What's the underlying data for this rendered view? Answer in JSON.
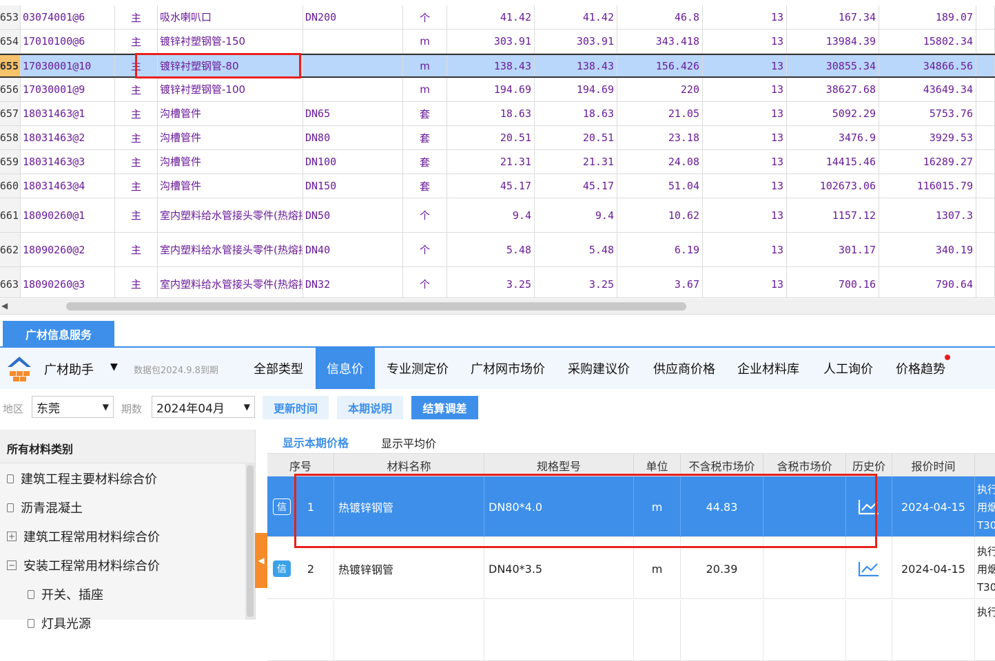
{
  "top_grid": {
    "rows": [
      {
        "idx": "653",
        "code": "03074001@6",
        "type": "主",
        "name": "吸水喇叭口",
        "spec": "DN200",
        "unit": "个",
        "p1": "41.42",
        "p2": "41.42",
        "p3": "46.8",
        "p4": "13",
        "p5": "167.34",
        "p6": "189.07"
      },
      {
        "idx": "654",
        "code": "17010100@6",
        "type": "主",
        "name": "镀锌衬塑钢管-150",
        "spec": "",
        "unit": "m",
        "p1": "303.91",
        "p2": "303.91",
        "p3": "343.418",
        "p4": "13",
        "p5": "13984.39",
        "p6": "15802.34"
      },
      {
        "idx": "655",
        "code": "17030001@10",
        "type": "主",
        "name": "镀锌衬塑钢管-80",
        "spec": "",
        "unit": "m",
        "p1": "138.43",
        "p2": "138.43",
        "p3": "156.426",
        "p4": "13",
        "p5": "30855.34",
        "p6": "34866.56"
      },
      {
        "idx": "656",
        "code": "17030001@9",
        "type": "主",
        "name": "镀锌衬塑钢管-100",
        "spec": "",
        "unit": "m",
        "p1": "194.69",
        "p2": "194.69",
        "p3": "220",
        "p4": "13",
        "p5": "38627.68",
        "p6": "43649.34"
      },
      {
        "idx": "657",
        "code": "18031463@1",
        "type": "主",
        "name": "沟槽管件",
        "spec": "DN65",
        "unit": "套",
        "p1": "18.63",
        "p2": "18.63",
        "p3": "21.05",
        "p4": "13",
        "p5": "5092.29",
        "p6": "5753.76"
      },
      {
        "idx": "658",
        "code": "18031463@2",
        "type": "主",
        "name": "沟槽管件",
        "spec": "DN80",
        "unit": "套",
        "p1": "20.51",
        "p2": "20.51",
        "p3": "23.18",
        "p4": "13",
        "p5": "3476.9",
        "p6": "3929.53"
      },
      {
        "idx": "659",
        "code": "18031463@3",
        "type": "主",
        "name": "沟槽管件",
        "spec": "DN100",
        "unit": "套",
        "p1": "21.31",
        "p2": "21.31",
        "p3": "24.08",
        "p4": "13",
        "p5": "14415.46",
        "p6": "16289.27"
      },
      {
        "idx": "660",
        "code": "18031463@4",
        "type": "主",
        "name": "沟槽管件",
        "spec": "DN150",
        "unit": "套",
        "p1": "45.17",
        "p2": "45.17",
        "p3": "51.04",
        "p4": "13",
        "p5": "102673.06",
        "p6": "116015.79"
      },
      {
        "idx": "661",
        "code": "18090260@1",
        "type": "主",
        "name": "室内塑料给水管接头零件(热熔接)",
        "spec": "DN50",
        "unit": "个",
        "p1": "9.4",
        "p2": "9.4",
        "p3": "10.62",
        "p4": "13",
        "p5": "1157.12",
        "p6": "1307.3"
      },
      {
        "idx": "662",
        "code": "18090260@2",
        "type": "主",
        "name": "室内塑料给水管接头零件(热熔接)",
        "spec": "DN40",
        "unit": "个",
        "p1": "5.48",
        "p2": "5.48",
        "p3": "6.19",
        "p4": "13",
        "p5": "301.17",
        "p6": "340.19"
      },
      {
        "idx": "663",
        "code": "18090260@3",
        "type": "主",
        "name": "室内塑料给水管接头零件(热熔接)",
        "spec": "DN32",
        "unit": "个",
        "p1": "3.25",
        "p2": "3.25",
        "p3": "3.67",
        "p4": "13",
        "p5": "700.16",
        "p6": "790.64"
      }
    ],
    "selected_index": 2,
    "ellipsis": "···"
  },
  "service": {
    "tab_label": "广材信息服务",
    "assistant_label": "广材助手",
    "package_text": "数据包2024.9.8到期",
    "nav_tabs": [
      "全部类型",
      "信息价",
      "专业测定价",
      "广材网市场价",
      "采购建议价",
      "供应商价格",
      "企业材料库",
      "人工询价",
      "价格趋势"
    ],
    "active_tab": 1
  },
  "filter": {
    "region_label": "地区",
    "region_value": "东莞",
    "period_label": "期数",
    "period_value": "2024年04月",
    "btn_update": "更新时间",
    "btn_desc": "本期说明",
    "btn_settle": "结算调差"
  },
  "tree": {
    "title": "所有材料类别",
    "items": [
      {
        "label": "建筑工程主要材料综合价",
        "icon": "doc-icon"
      },
      {
        "label": "沥青混凝土",
        "icon": "doc-icon"
      },
      {
        "label": "建筑工程常用材料综合价",
        "icon": "expand-plus-icon"
      },
      {
        "label": "安装工程常用材料综合价",
        "icon": "collapse-minus-icon"
      },
      {
        "label": "开关、插座",
        "icon": "doc-icon"
      },
      {
        "label": "灯具光源",
        "icon": "doc-icon"
      }
    ]
  },
  "results": {
    "tab_current": "显示本期价格",
    "tab_avg": "显示平均价",
    "headers": [
      "序号",
      "材料名称",
      "规格型号",
      "单位",
      "不含税市场价",
      "含税市场价",
      "历史价",
      "报价时间"
    ],
    "rows": [
      {
        "badge": "信",
        "no": "1",
        "name": "热镀锌钢管",
        "spec": "DN80*4.0",
        "unit": "m",
        "price_ex": "44.83",
        "price_in": "",
        "date": "2024-04-15",
        "note": [
          "执行",
          "用烟",
          "T30"
        ]
      },
      {
        "badge": "信",
        "no": "2",
        "name": "热镀锌钢管",
        "spec": "DN40*3.5",
        "unit": "m",
        "price_ex": "20.39",
        "price_in": "",
        "date": "2024-04-15",
        "note": [
          "执行",
          "用烟",
          "T30"
        ]
      },
      {
        "badge": "",
        "no": "",
        "name": "",
        "spec": "",
        "unit": "",
        "price_ex": "",
        "price_in": "",
        "date": "",
        "note": [
          "执行"
        ]
      }
    ]
  },
  "colors": {
    "accent": "#3d8fea",
    "highlight_box": "#e8211c",
    "purple_text": "#6a1b9a",
    "orange": "#f58b2a"
  }
}
